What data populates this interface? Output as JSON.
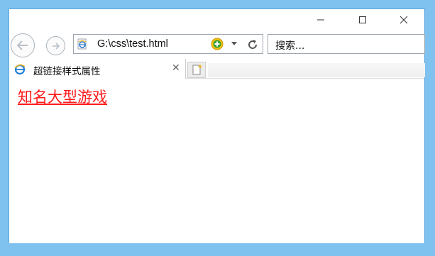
{
  "window": {
    "minimize_glyph": "—",
    "maximize_glyph": "☐",
    "close_glyph": "✕"
  },
  "toolbar": {
    "address": "G:\\css\\test.html",
    "search_placeholder": "搜索..."
  },
  "tabs": [
    {
      "label": "超链接样式属性",
      "close_glyph": "✕",
      "active": true
    }
  ],
  "page": {
    "link_text": "知名大型游戏",
    "link_color": "#ff1a1a"
  },
  "colors": {
    "desktop": "#7fc1ef",
    "window_border": "#5aa7de"
  },
  "icons": {
    "back": "arrow-left-icon",
    "forward": "arrow-right-icon",
    "favicon": "ie-page-icon",
    "compat": "plus-circle-icon",
    "dropdown": "chevron-down-icon",
    "refresh": "refresh-icon",
    "new_tab": "new-tab-icon"
  }
}
